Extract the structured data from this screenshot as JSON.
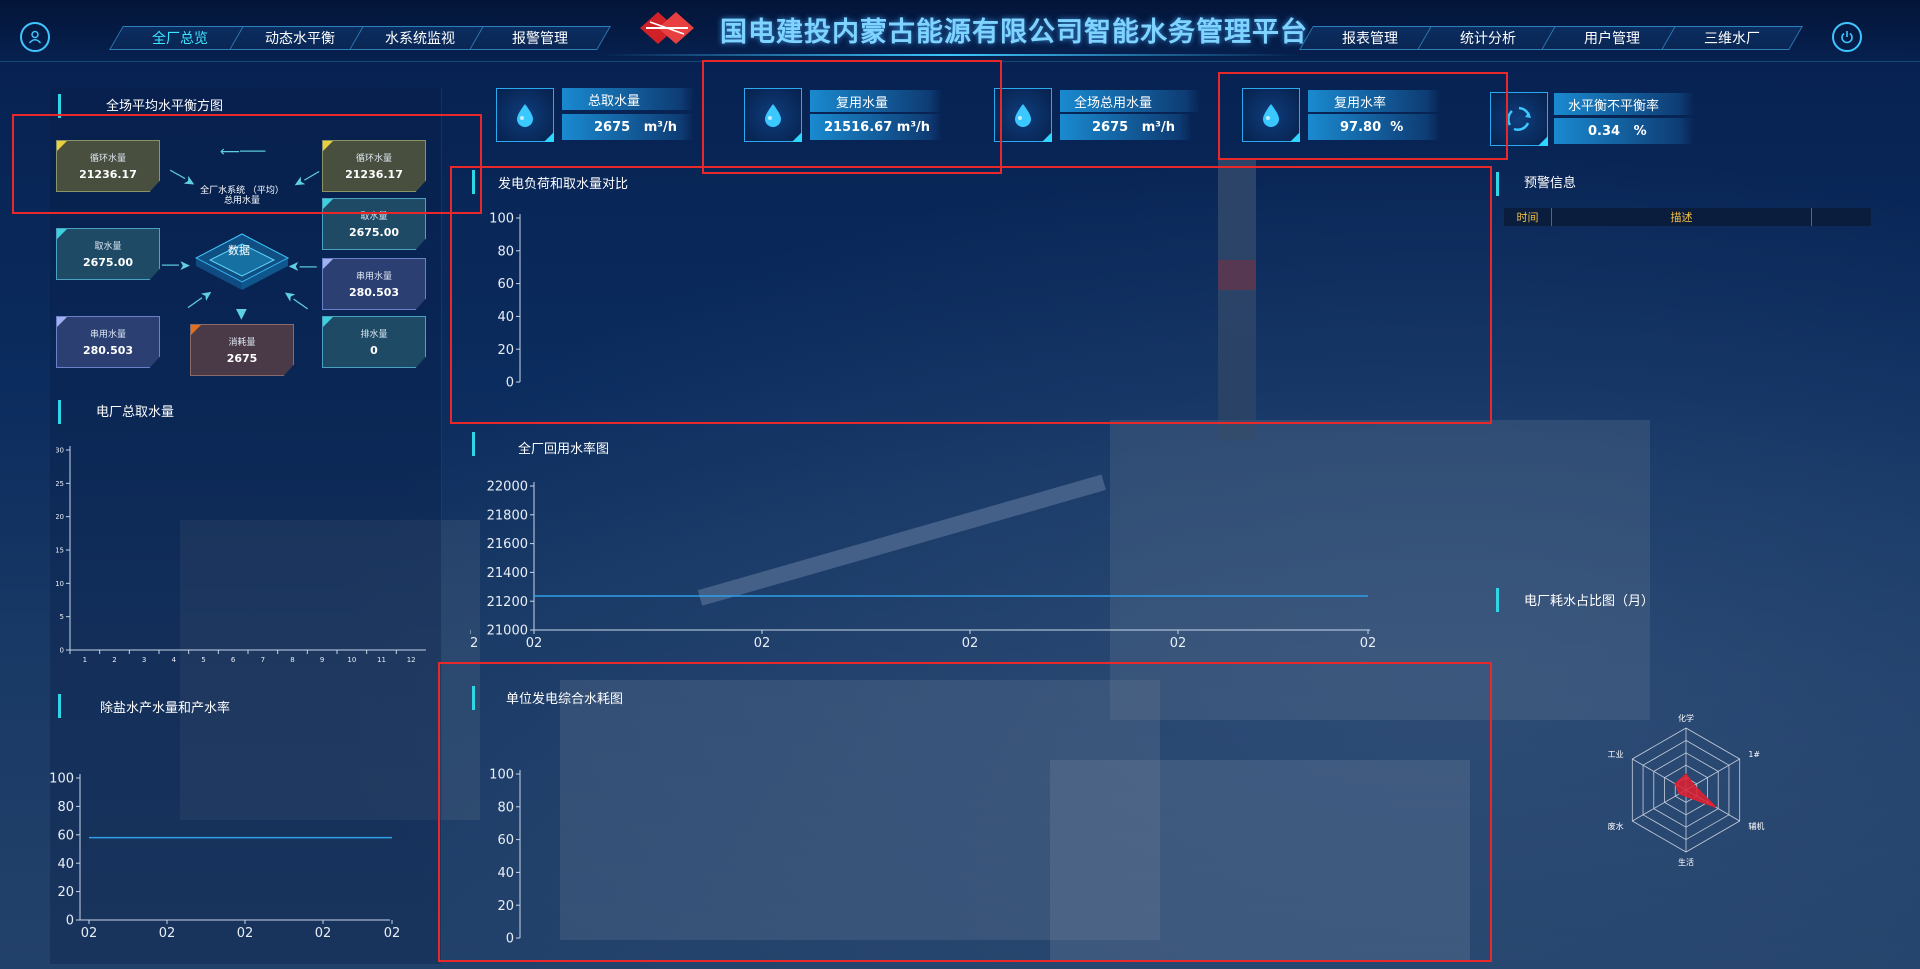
{
  "header": {
    "title": "国电建投内蒙古能源有限公司智能水务管理平台",
    "left_tabs": [
      {
        "label": "全厂总览",
        "active": true
      },
      {
        "label": "动态水平衡",
        "active": false
      },
      {
        "label": "水系统监视",
        "active": false
      },
      {
        "label": "报警管理",
        "active": false
      }
    ],
    "right_tabs": [
      {
        "label": "报表管理"
      },
      {
        "label": "统计分析"
      },
      {
        "label": "用户管理"
      },
      {
        "label": "三维水厂"
      }
    ],
    "left_icon": "user-icon",
    "right_icon": "power-icon"
  },
  "kpis": [
    {
      "label": "总取水量",
      "value": "2675",
      "unit": "m³/h",
      "icon": "water-drop-icon"
    },
    {
      "label": "复用水量",
      "value": "21516.67",
      "unit": "m³/h",
      "icon": "water-drop-icon"
    },
    {
      "label": "全场总用水量",
      "value": "2675",
      "unit": "m³/h",
      "icon": "water-drop-icon"
    },
    {
      "label": "复用水率",
      "value": "97.80",
      "unit": "%",
      "icon": "water-drop-icon"
    },
    {
      "label": "水平衡不平衡率",
      "value": "0.34",
      "unit": "%",
      "icon": "recycle-icon"
    }
  ],
  "water_balance": {
    "title": "全场平均水平衡方图",
    "center_label": "全厂水系统 （平均）总用水量",
    "data_label": "数据",
    "boxes": {
      "circulating_left": {
        "label": "循环水量",
        "value": "21236.17"
      },
      "circulating_right": {
        "label": "循环水量",
        "value": "21236.17"
      },
      "intake_left": {
        "label": "取水量",
        "value": "2675.00"
      },
      "intake_right": {
        "label": "取水量",
        "value": "2675.00"
      },
      "serial_right": {
        "label": "串用水量",
        "value": "280.503"
      },
      "serial_left": {
        "label": "串用水量",
        "value": "280.503"
      },
      "consumption": {
        "label": "消耗量",
        "value": "2675"
      },
      "discharge": {
        "label": "排水量",
        "value": "0"
      }
    }
  },
  "plant_intake": {
    "title": "电厂总取水量",
    "chart_data": {
      "type": "bar",
      "categories": [
        "1",
        "2",
        "3",
        "4",
        "5",
        "6",
        "7",
        "8",
        "9",
        "10",
        "11",
        "12"
      ],
      "y_ticks": [
        "0",
        "5",
        "10",
        "15",
        "20",
        "25",
        "30"
      ],
      "ylim": [
        0,
        30
      ],
      "values": []
    }
  },
  "desalination": {
    "title": "除盐水产水量和产水率",
    "chart_data": {
      "type": "line",
      "x_ticks": [
        "02",
        "02",
        "02",
        "02",
        "02"
      ],
      "y_ticks": [
        "0",
        "20",
        "40",
        "60",
        "80",
        "100"
      ],
      "ylim": [
        0,
        100
      ],
      "series": [
        {
          "values": [
            58,
            58,
            58,
            58,
            58
          ]
        }
      ]
    }
  },
  "load_vs_intake": {
    "title": "发电负荷和取水量对比",
    "chart_data": {
      "type": "line",
      "y_ticks": [
        "0",
        "20",
        "40",
        "60",
        "80",
        "100"
      ],
      "ylim": [
        0,
        100
      ],
      "series": []
    }
  },
  "reuse_rate": {
    "title": "全厂回用水率图",
    "chart_data": {
      "type": "line",
      "x_ticks": [
        "02",
        "02",
        "02",
        "02",
        "02",
        "02"
      ],
      "y_ticks": [
        "21000",
        "21200",
        "21400",
        "21600",
        "21800",
        "22000"
      ],
      "ylim": [
        21000,
        22000
      ],
      "series": [
        {
          "values": [
            21236.17,
            21236.17,
            21236.17,
            21236.17,
            21236.17,
            21236.17
          ]
        }
      ]
    }
  },
  "unit_consumption": {
    "title": "单位发电综合水耗图",
    "chart_data": {
      "type": "line",
      "y_ticks": [
        "0",
        "20",
        "40",
        "60",
        "80",
        "100"
      ],
      "ylim": [
        0,
        100
      ],
      "series": []
    }
  },
  "alerts": {
    "title": "预警信息",
    "columns": [
      "时间",
      "描述",
      ""
    ]
  },
  "consumption_ratio": {
    "title": "电厂耗水占比图（月）",
    "chart_data": {
      "type": "radar",
      "axes": [
        "化学",
        "1#",
        "辅机",
        "生活",
        "废水",
        "工业"
      ],
      "values": [
        0.25,
        0.15,
        0.55,
        0.1,
        0.12,
        0.2
      ],
      "colors": {
        "series": "#e02030",
        "grid": "#c8d0dc"
      }
    }
  }
}
